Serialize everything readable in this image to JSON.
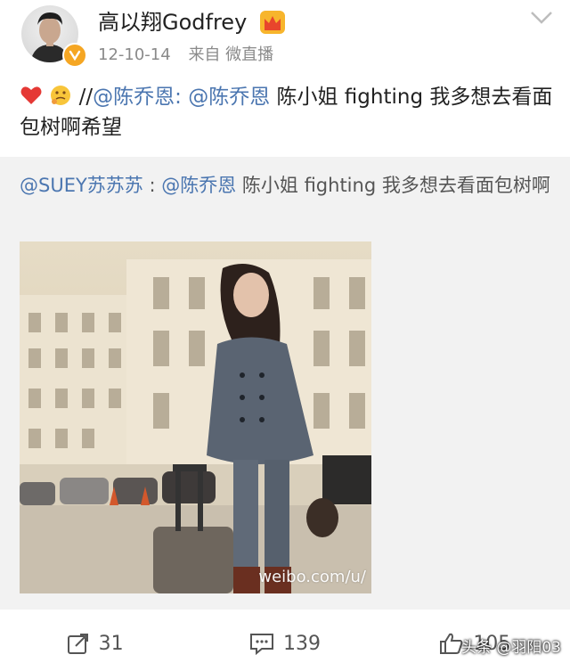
{
  "post": {
    "author": "高以翔Godfrey",
    "date": "12-10-14",
    "source": "来自 微直播",
    "text_parts": {
      "prefix": "//",
      "mention1": "@陈乔恩:",
      "mention2": "@陈乔恩",
      "body_line": " 陈小姐  fighting  我多想去看面包树啊希望"
    }
  },
  "repost": {
    "mention1": "@SUEY苏苏苏",
    "separator": " : ",
    "mention2": "@陈乔恩",
    "body": " 陈小姐  fighting  我多想去看面包树啊",
    "image_watermark": "weibo.com/u/"
  },
  "actions": {
    "repost_count": "31",
    "comment_count": "139",
    "like_count": "105"
  },
  "overlay": {
    "credit": "头条 @羽阳03"
  },
  "colors": {
    "link": "#4b76b0",
    "meta": "#8a8a8a",
    "repost_bg": "#f2f2f2",
    "verified_badge": "#f5a623"
  }
}
